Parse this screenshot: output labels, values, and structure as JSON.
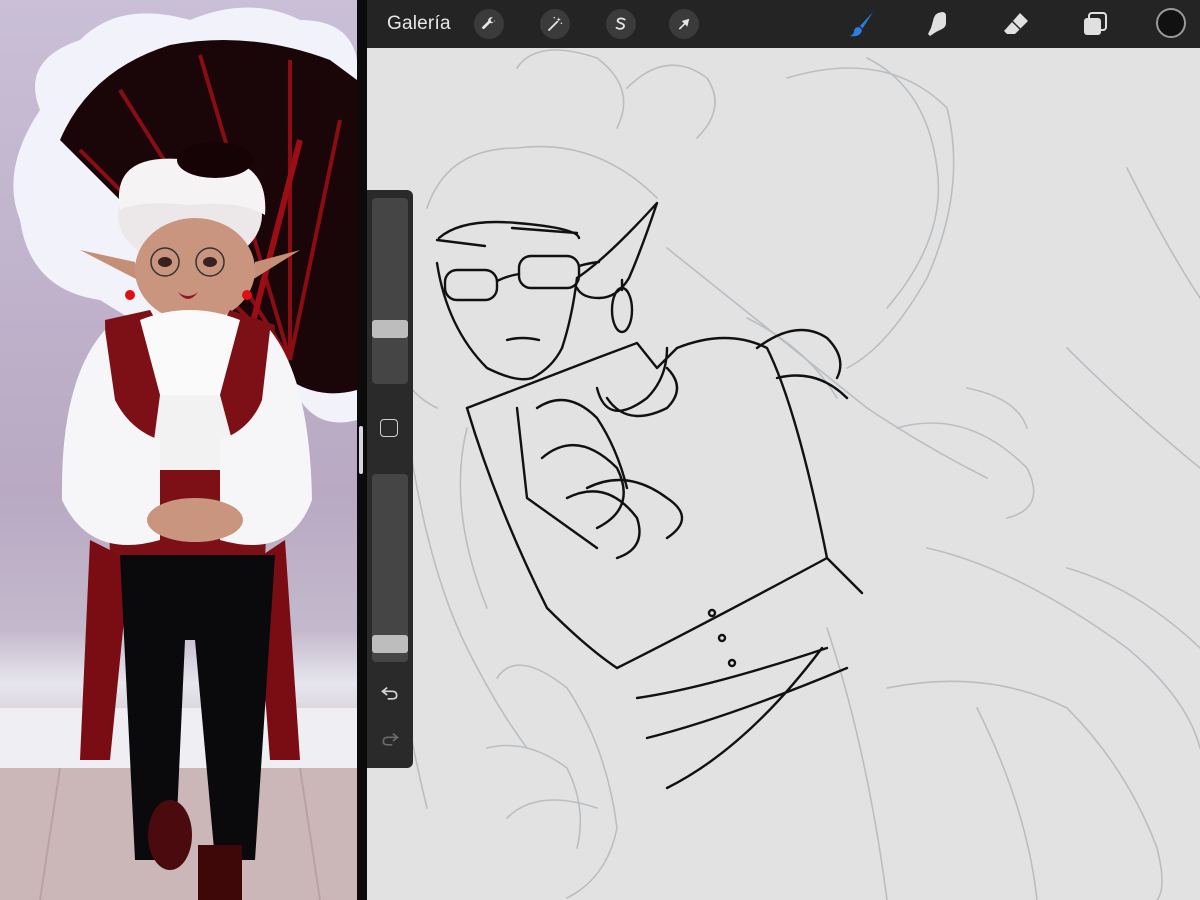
{
  "toolbar": {
    "gallery_label": "Galería",
    "actions_icons": [
      "wrench-icon",
      "magic-wand-icon",
      "selection-s-icon",
      "transform-arrow-icon"
    ],
    "tools": [
      "brush-icon",
      "smudge-icon",
      "eraser-icon",
      "layers-icon"
    ],
    "active_tool": "brush-icon",
    "current_color": "#111111",
    "active_color_accent": "#2a7fe0"
  },
  "sidebar": {
    "brush_size_level": 0.26,
    "opacity_level": 0.04,
    "controls": [
      "brush-size-slider",
      "modify-square-button",
      "opacity-slider",
      "undo-icon",
      "redo-icon"
    ]
  }
}
